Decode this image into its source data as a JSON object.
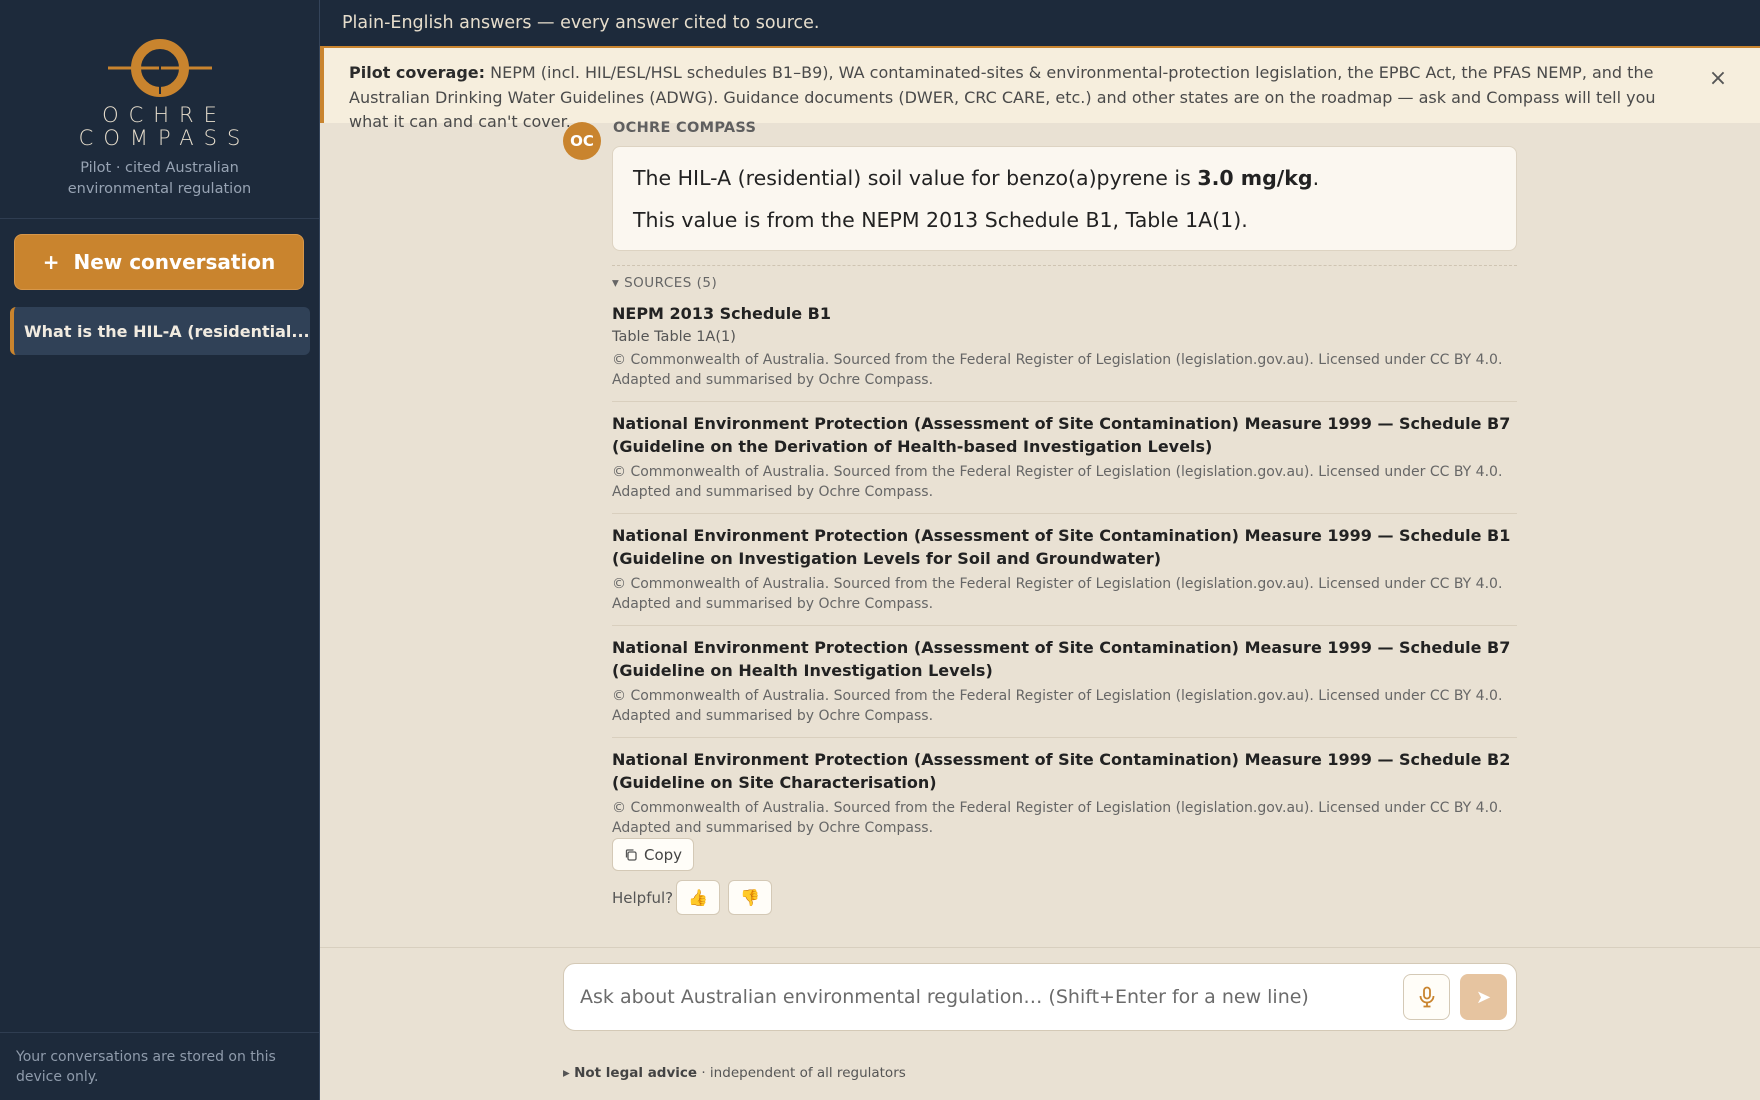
{
  "sidebar": {
    "brand_line1": "OCHRE",
    "brand_line2": "COMPASS",
    "tagline": "Pilot · cited Australian environmental regulation",
    "new_conversation_label": "New conversation",
    "new_conversation_icon": "plus-icon",
    "conversations": [
      {
        "label": "What is the HIL-A (residential..."
      }
    ],
    "footer": "Your conversations are stored on this device only."
  },
  "header": {
    "title": "Plain-English answers — every answer cited to source."
  },
  "banner": {
    "label": "Pilot coverage:",
    "text": "NEPM (incl. HIL/ESL/HSL schedules B1–B9), WA contaminated-sites & environmental-protection legislation, the EPBC Act, the PFAS NEMP, and the Australian Drinking Water Guidelines (ADWG). Guidance documents (DWER, CRC CARE, etc.) and other states are on the roadmap — ask and Compass will tell you what it can and can't cover.",
    "close_icon": "close-icon",
    "close_glyph": "×"
  },
  "message": {
    "avatar": "OC",
    "sender": "OCHRE COMPASS",
    "answer_pre": "The HIL-A (residential) soil value for benzo(a)pyrene is ",
    "answer_value": "3.0 mg/kg",
    "answer_post": ".",
    "answer_line2": "This value is from the NEPM 2013 Schedule B1, Table 1A(1).",
    "sources_toggle": "▾ SOURCES (5)",
    "sources": [
      {
        "title": "NEPM 2013 Schedule B1",
        "subtitle": "Table Table 1A(1)",
        "license": "© Commonwealth of Australia. Sourced from the Federal Register of Legislation (legislation.gov.au). Licensed under CC BY 4.0. Adapted and summarised by Ochre Compass."
      },
      {
        "title": "National Environment Protection (Assessment of Site Contamination) Measure 1999 — Schedule B7 (Guideline on the Derivation of Health-based Investigation Levels)",
        "license": "© Commonwealth of Australia. Sourced from the Federal Register of Legislation (legislation.gov.au). Licensed under CC BY 4.0. Adapted and summarised by Ochre Compass."
      },
      {
        "title": "National Environment Protection (Assessment of Site Contamination) Measure 1999 — Schedule B1 (Guideline on Investigation Levels for Soil and Groundwater)",
        "license": "© Commonwealth of Australia. Sourced from the Federal Register of Legislation (legislation.gov.au). Licensed under CC BY 4.0. Adapted and summarised by Ochre Compass."
      },
      {
        "title": "National Environment Protection (Assessment of Site Contamination) Measure 1999 — Schedule B7 (Guideline on Health Investigation Levels)",
        "license": "© Commonwealth of Australia. Sourced from the Federal Register of Legislation (legislation.gov.au). Licensed under CC BY 4.0. Adapted and summarised by Ochre Compass."
      },
      {
        "title": "National Environment Protection (Assessment of Site Contamination) Measure 1999 — Schedule B2 (Guideline on Site Characterisation)",
        "license": "© Commonwealth of Australia. Sourced from the Federal Register of Legislation (legislation.gov.au). Licensed under CC BY 4.0. Adapted and summarised by Ochre Compass."
      }
    ],
    "copy_label": "Copy",
    "copy_icon": "copy-icon",
    "helpful_label": "Helpful?",
    "thumbs_up": "👍",
    "thumbs_down": "👎"
  },
  "composer": {
    "placeholder": "Ask about Australian environmental regulation… (Shift+Enter for a new line)",
    "value": "",
    "mic_icon": "microphone-icon",
    "send_icon": "send-icon",
    "send_glyph": "➤"
  },
  "legal": {
    "toggle": "▸",
    "bold": "Not legal advice",
    "rest": " · independent of all regulators"
  },
  "colors": {
    "accent": "#c9842e",
    "sidebar_bg": "#1d2a3b",
    "main_bg": "#e9e1d3",
    "banner_bg": "#f6eedd"
  }
}
